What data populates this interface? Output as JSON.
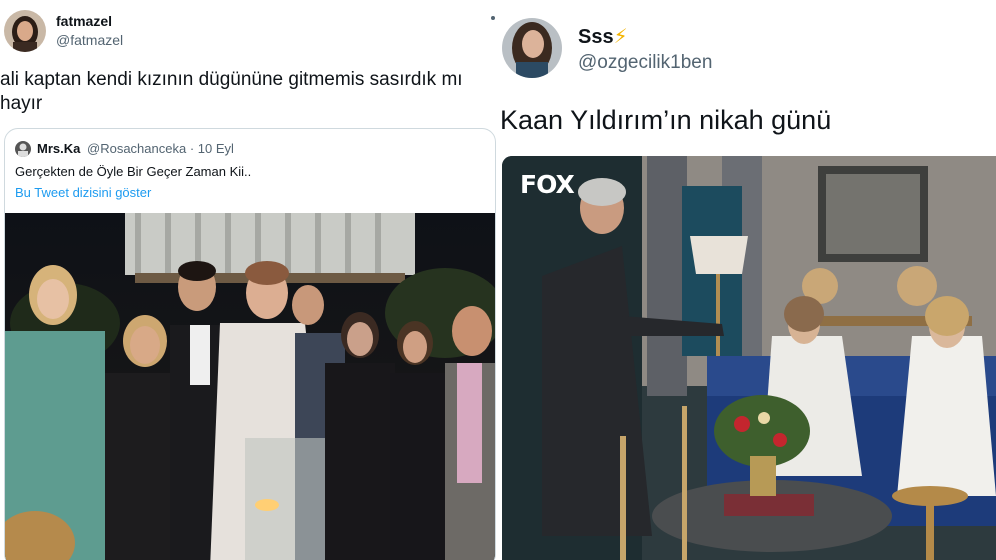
{
  "left_tweet": {
    "author": {
      "name": "fatmazel",
      "handle": "@fatmazel",
      "avatar": "avatar-woman-dark-hair"
    },
    "text": "ali kaptan kendi kızının dügününe gitmemis sasırdık mı hayır",
    "quoted_tweet": {
      "author": {
        "name": "Mrs.Ka",
        "handle": "@Rosachanceka",
        "date": "10 Eyl"
      },
      "text": "Gerçekten de Öyle Bir Geçer Zaman Kii..",
      "thread_link": "Bu Tweet dizisini göster",
      "photo": "wedding-group-photo"
    }
  },
  "right_tweet": {
    "author": {
      "name": "Sss",
      "emoji": "⚡",
      "handle": "@ozgecilik1ben",
      "avatar": "avatar-woman-long-hair"
    },
    "text": "Kaan Yıldırım’ın nikah günü",
    "photo": {
      "channel_logo": "FOX",
      "scene": "tv-wedding-scene"
    }
  },
  "colors": {
    "text": "#0f1419",
    "secondary": "#536471",
    "link": "#1d9bf0",
    "border": "#cfd9de"
  }
}
